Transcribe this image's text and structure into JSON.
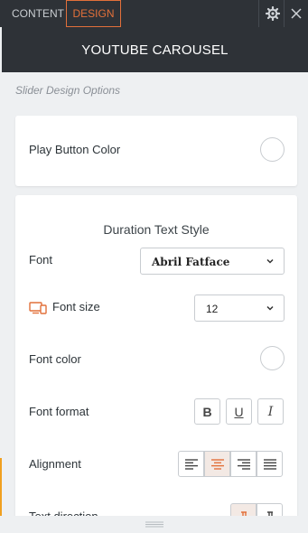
{
  "tabs": {
    "content": "CONTENT",
    "design": "DESIGN"
  },
  "header": {
    "title": "YOUTUBE CAROUSEL"
  },
  "section": {
    "label": "Slider Design Options"
  },
  "play_button": {
    "label": "Play Button Color"
  },
  "duration": {
    "title": "Duration Text Style",
    "font_label": "Font",
    "font_value": "Abril Fatface",
    "font_size_label": "Font size",
    "font_size_value": "12",
    "font_color_label": "Font color",
    "font_format_label": "Font format",
    "alignment_label": "Alignment",
    "text_direction_label": "Text direction",
    "format_buttons": {
      "bold": "B",
      "underline": "U",
      "italic": "I"
    },
    "alignment_selected": "center"
  },
  "colors": {
    "accent": "#e2703a",
    "dark": "#2e3237"
  }
}
